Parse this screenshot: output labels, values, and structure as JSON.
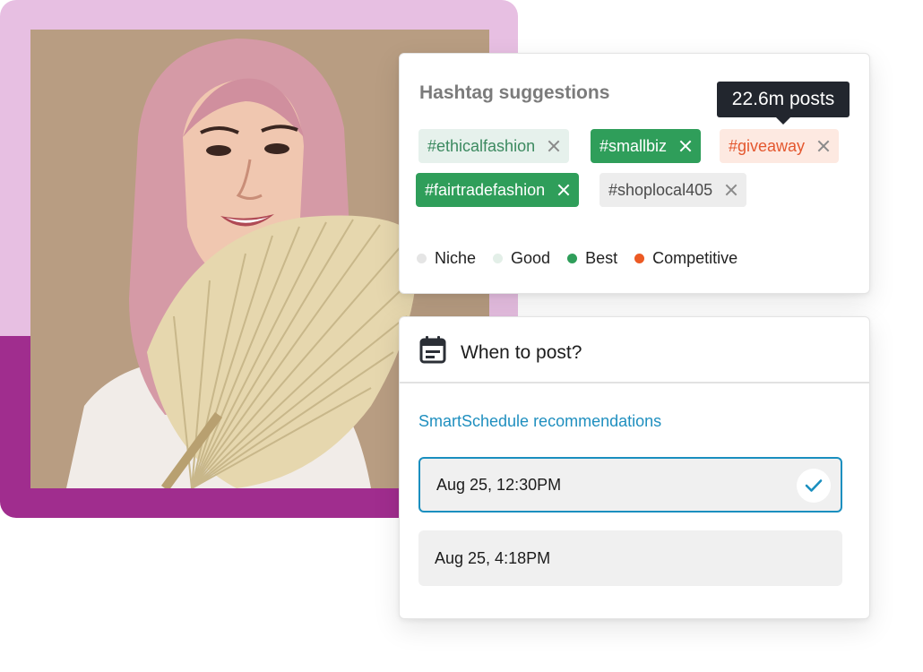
{
  "hashtags": {
    "title": "Hashtag suggestions",
    "tooltip": "22.6m posts",
    "chips": [
      {
        "label": "#ethicalfashion",
        "category": "Good"
      },
      {
        "label": "#smallbiz",
        "category": "Best"
      },
      {
        "label": "#giveaway",
        "category": "Competitive"
      },
      {
        "label": "#fairtradefashion",
        "category": "Best"
      },
      {
        "label": "#shoplocal405",
        "category": "Niche"
      }
    ],
    "legend": [
      {
        "label": "Niche",
        "color": "#e5e5e5"
      },
      {
        "label": "Good",
        "color": "#e3efe8"
      },
      {
        "label": "Best",
        "color": "#2f9e5a"
      },
      {
        "label": "Competitive",
        "color": "#ec5a24"
      }
    ]
  },
  "schedule": {
    "title": "When to post?",
    "recommendations_link": "SmartSchedule recommendations",
    "slots": [
      {
        "label": "Aug 25, 12:30PM",
        "selected": true
      },
      {
        "label": "Aug 25, 4:18PM",
        "selected": false
      }
    ]
  },
  "colors": {
    "backdrop_light": "#e7bfe2",
    "backdrop_dark": "#a02d8e",
    "accent_blue": "#1a8fbf"
  }
}
